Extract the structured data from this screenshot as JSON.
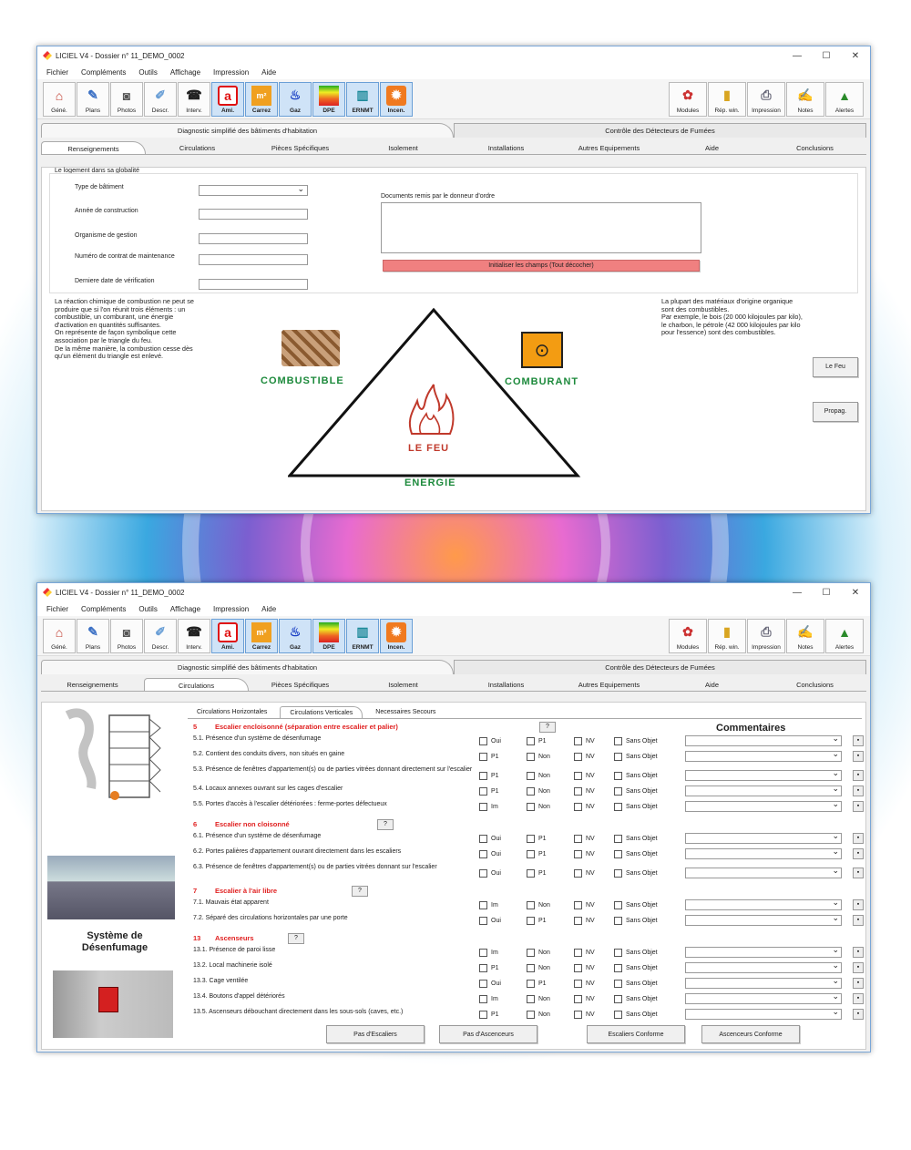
{
  "app_title": "LICIEL V4 - Dossier n° 11_DEMO_0002",
  "menu": [
    "Fichier",
    "Compléments",
    "Outils",
    "Affichage",
    "Impression",
    "Aide"
  ],
  "toolbar_left": [
    {
      "label": "Géné.",
      "icon": "house-icon",
      "color": "#c0392b"
    },
    {
      "label": "Plans",
      "icon": "pencil-icon",
      "color": "#3a6fc4"
    },
    {
      "label": "Photos",
      "icon": "camera-icon",
      "color": "#555555"
    },
    {
      "label": "Descr.",
      "icon": "brush-icon",
      "color": "#6a9fd6"
    },
    {
      "label": "Interv.",
      "icon": "phone-icon",
      "color": "#222222"
    },
    {
      "label": "Ami.",
      "icon": "amiante-icon",
      "color": "#e01010"
    },
    {
      "label": "Carrez",
      "icon": "m2-icon",
      "color": "#e08a10"
    },
    {
      "label": "Gaz",
      "icon": "flame-icon",
      "color": "#1a3fc4"
    },
    {
      "label": "DPE",
      "icon": "energy-label-icon",
      "color": "#2aa02a"
    },
    {
      "label": "ERNMT",
      "icon": "factory-icon",
      "color": "#1e8a9a"
    },
    {
      "label": "Incen.",
      "icon": "fire-icon",
      "color": "#e0601a"
    }
  ],
  "toolbar_right": [
    {
      "label": "Modules",
      "icon": "modules-icon"
    },
    {
      "label": "Rép. win.",
      "icon": "folder-icon"
    },
    {
      "label": "Impression",
      "icon": "printer-icon"
    },
    {
      "label": "Notes",
      "icon": "notes-icon"
    },
    {
      "label": "Alertes",
      "icon": "alert-icon"
    }
  ],
  "main_tabs": [
    "Diagnostic simplifié des bâtiments d'habitation",
    "Contrôle des Détecteurs de Fumées"
  ],
  "sub_tabs": [
    "Renseignements",
    "Circulations",
    "Pièces Spécifiques",
    "Isolement",
    "Installations",
    "Autres Equipements",
    "Aide",
    "Conclusions"
  ],
  "win1": {
    "group_title": "Le logement dans sa globalité",
    "fields": [
      "Type de bâtiment",
      "Année de construction",
      "Organisme de gestion",
      "Numéro de contrat de maintenance",
      "Derniere date de vérification"
    ],
    "docs_label": "Documents remis par le donneur d'ordre",
    "reset_button": "Initialiser les champs (Tout décocher)",
    "left_text": "La réaction chimique de combustion ne peut se produire que si l'on réunit trois éléments : un combustible, un comburant, une énergie d'activation en quantités suffisantes.\nOn représente de façon symbolique cette association par le triangle du feu.\nDe la même manière, la combustion cesse dès qu'un élément du triangle est enlevé.",
    "right_text": "La plupart des matériaux d'origine organique sont des combustibles.\nPar exemple, le bois (20 000 kilojoules par kilo), le charbon, le pétrole (42 000 kilojoules par kilo pour l'essence) sont des combustibles.",
    "triangle": {
      "combustible": "COMBUSTIBLE",
      "comburant": "COMBURANT",
      "feu": "LE FEU",
      "energie": "ENERGIE"
    },
    "side_buttons": [
      "Le Feu",
      "Propag."
    ]
  },
  "win2": {
    "inner_tabs": [
      "Circulations Horizontales",
      "Circulations Verticales",
      "Necessaires Secours"
    ],
    "comments_title": "Commentaires",
    "image_caption": "Système de\nDésenfumage",
    "sections": [
      {
        "num": "5",
        "title": "Escalier encloisonné (séparation entre escalier et palier)",
        "rows": [
          {
            "t": "5.1.  Présence d'un système de désenfumage",
            "a": "Oui",
            "b": "P1"
          },
          {
            "t": "5.2.  Contient des conduits divers, non situés en gaine",
            "a": "P1",
            "b": "Non"
          },
          {
            "t": "5.3.  Présence de fenêtres d'appartement(s) ou de parties vitrées donnant directement sur l'escalier",
            "a": "P1",
            "b": "Non"
          },
          {
            "t": "5.4.  Locaux annexes ouvrant sur les cages d'escalier",
            "a": "P1",
            "b": "Non"
          },
          {
            "t": "5.5.  Portes d'accès à l'escalier détériorées : ferme-portes défectueux",
            "a": "Im",
            "b": "Non"
          }
        ]
      },
      {
        "num": "6",
        "title": "Escalier non cloisonné",
        "rows": [
          {
            "t": "6.1.  Présence d'un système de désenfumage",
            "a": "Oui",
            "b": "P1"
          },
          {
            "t": "6.2.  Portes palières d'appartement ouvrant directement dans les escaliers",
            "a": "Oui",
            "b": "P1"
          },
          {
            "t": "6.3.  Présence de fenêtres d'appartement(s) ou de parties vitrées donnant sur l'escalier",
            "a": "Oui",
            "b": "P1"
          }
        ]
      },
      {
        "num": "7",
        "title": "Escalier à l'air libre",
        "rows": [
          {
            "t": "7.1.  Mauvais état apparent",
            "a": "Im",
            "b": "Non"
          },
          {
            "t": "7.2.  Séparé des circulations horizontales par une porte",
            "a": "Oui",
            "b": "P1"
          }
        ]
      },
      {
        "num": "13",
        "title": "Ascenseurs",
        "rows": [
          {
            "t": "13.1.  Présence de paroi lisse",
            "a": "Im",
            "b": "Non"
          },
          {
            "t": "13.2.  Local machinerie isolé",
            "a": "P1",
            "b": "Non"
          },
          {
            "t": "13.3.  Cage ventilée",
            "a": "Oui",
            "b": "P1"
          },
          {
            "t": "13.4.  Boutons d'appel détériorés",
            "a": "Im",
            "b": "Non"
          },
          {
            "t": "13.5.  Ascenseurs débouchant directement dans les sous-sols (caves, etc.)",
            "a": "P1",
            "b": "Non"
          }
        ]
      }
    ],
    "col_nv": "NV",
    "col_so": "Sans Objet",
    "bottom_buttons": [
      "Pas d'Escaliers",
      "Pas d'Ascenceurs",
      "Escaliers Conforme",
      "Ascenceurs Conforme"
    ]
  }
}
